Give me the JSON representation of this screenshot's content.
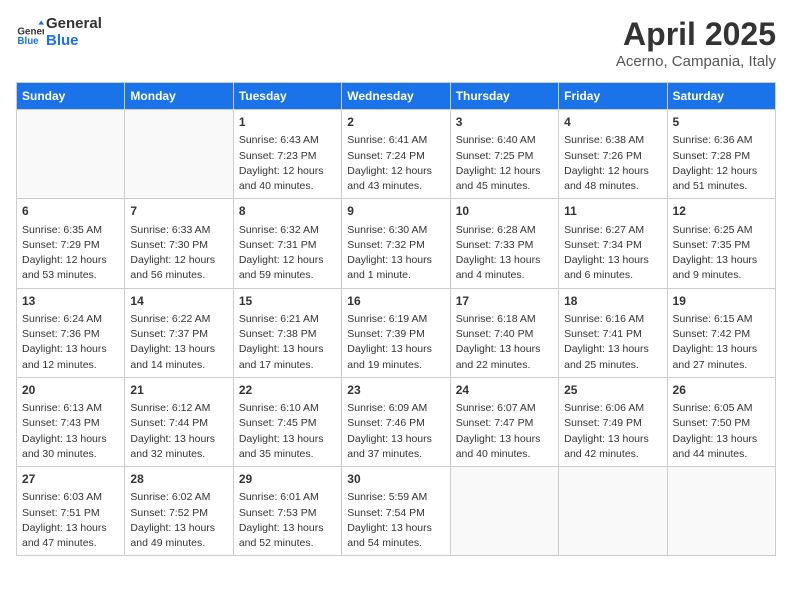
{
  "header": {
    "logo_line1": "General",
    "logo_line2": "Blue",
    "title": "April 2025",
    "subtitle": "Acerno, Campania, Italy"
  },
  "days_of_week": [
    "Sunday",
    "Monday",
    "Tuesday",
    "Wednesday",
    "Thursday",
    "Friday",
    "Saturday"
  ],
  "weeks": [
    [
      {
        "day": "",
        "empty": true
      },
      {
        "day": "",
        "empty": true
      },
      {
        "day": "1",
        "sunrise": "Sunrise: 6:43 AM",
        "sunset": "Sunset: 7:23 PM",
        "daylight": "Daylight: 12 hours and 40 minutes."
      },
      {
        "day": "2",
        "sunrise": "Sunrise: 6:41 AM",
        "sunset": "Sunset: 7:24 PM",
        "daylight": "Daylight: 12 hours and 43 minutes."
      },
      {
        "day": "3",
        "sunrise": "Sunrise: 6:40 AM",
        "sunset": "Sunset: 7:25 PM",
        "daylight": "Daylight: 12 hours and 45 minutes."
      },
      {
        "day": "4",
        "sunrise": "Sunrise: 6:38 AM",
        "sunset": "Sunset: 7:26 PM",
        "daylight": "Daylight: 12 hours and 48 minutes."
      },
      {
        "day": "5",
        "sunrise": "Sunrise: 6:36 AM",
        "sunset": "Sunset: 7:28 PM",
        "daylight": "Daylight: 12 hours and 51 minutes."
      }
    ],
    [
      {
        "day": "6",
        "sunrise": "Sunrise: 6:35 AM",
        "sunset": "Sunset: 7:29 PM",
        "daylight": "Daylight: 12 hours and 53 minutes."
      },
      {
        "day": "7",
        "sunrise": "Sunrise: 6:33 AM",
        "sunset": "Sunset: 7:30 PM",
        "daylight": "Daylight: 12 hours and 56 minutes."
      },
      {
        "day": "8",
        "sunrise": "Sunrise: 6:32 AM",
        "sunset": "Sunset: 7:31 PM",
        "daylight": "Daylight: 12 hours and 59 minutes."
      },
      {
        "day": "9",
        "sunrise": "Sunrise: 6:30 AM",
        "sunset": "Sunset: 7:32 PM",
        "daylight": "Daylight: 13 hours and 1 minute."
      },
      {
        "day": "10",
        "sunrise": "Sunrise: 6:28 AM",
        "sunset": "Sunset: 7:33 PM",
        "daylight": "Daylight: 13 hours and 4 minutes."
      },
      {
        "day": "11",
        "sunrise": "Sunrise: 6:27 AM",
        "sunset": "Sunset: 7:34 PM",
        "daylight": "Daylight: 13 hours and 6 minutes."
      },
      {
        "day": "12",
        "sunrise": "Sunrise: 6:25 AM",
        "sunset": "Sunset: 7:35 PM",
        "daylight": "Daylight: 13 hours and 9 minutes."
      }
    ],
    [
      {
        "day": "13",
        "sunrise": "Sunrise: 6:24 AM",
        "sunset": "Sunset: 7:36 PM",
        "daylight": "Daylight: 13 hours and 12 minutes."
      },
      {
        "day": "14",
        "sunrise": "Sunrise: 6:22 AM",
        "sunset": "Sunset: 7:37 PM",
        "daylight": "Daylight: 13 hours and 14 minutes."
      },
      {
        "day": "15",
        "sunrise": "Sunrise: 6:21 AM",
        "sunset": "Sunset: 7:38 PM",
        "daylight": "Daylight: 13 hours and 17 minutes."
      },
      {
        "day": "16",
        "sunrise": "Sunrise: 6:19 AM",
        "sunset": "Sunset: 7:39 PM",
        "daylight": "Daylight: 13 hours and 19 minutes."
      },
      {
        "day": "17",
        "sunrise": "Sunrise: 6:18 AM",
        "sunset": "Sunset: 7:40 PM",
        "daylight": "Daylight: 13 hours and 22 minutes."
      },
      {
        "day": "18",
        "sunrise": "Sunrise: 6:16 AM",
        "sunset": "Sunset: 7:41 PM",
        "daylight": "Daylight: 13 hours and 25 minutes."
      },
      {
        "day": "19",
        "sunrise": "Sunrise: 6:15 AM",
        "sunset": "Sunset: 7:42 PM",
        "daylight": "Daylight: 13 hours and 27 minutes."
      }
    ],
    [
      {
        "day": "20",
        "sunrise": "Sunrise: 6:13 AM",
        "sunset": "Sunset: 7:43 PM",
        "daylight": "Daylight: 13 hours and 30 minutes."
      },
      {
        "day": "21",
        "sunrise": "Sunrise: 6:12 AM",
        "sunset": "Sunset: 7:44 PM",
        "daylight": "Daylight: 13 hours and 32 minutes."
      },
      {
        "day": "22",
        "sunrise": "Sunrise: 6:10 AM",
        "sunset": "Sunset: 7:45 PM",
        "daylight": "Daylight: 13 hours and 35 minutes."
      },
      {
        "day": "23",
        "sunrise": "Sunrise: 6:09 AM",
        "sunset": "Sunset: 7:46 PM",
        "daylight": "Daylight: 13 hours and 37 minutes."
      },
      {
        "day": "24",
        "sunrise": "Sunrise: 6:07 AM",
        "sunset": "Sunset: 7:47 PM",
        "daylight": "Daylight: 13 hours and 40 minutes."
      },
      {
        "day": "25",
        "sunrise": "Sunrise: 6:06 AM",
        "sunset": "Sunset: 7:49 PM",
        "daylight": "Daylight: 13 hours and 42 minutes."
      },
      {
        "day": "26",
        "sunrise": "Sunrise: 6:05 AM",
        "sunset": "Sunset: 7:50 PM",
        "daylight": "Daylight: 13 hours and 44 minutes."
      }
    ],
    [
      {
        "day": "27",
        "sunrise": "Sunrise: 6:03 AM",
        "sunset": "Sunset: 7:51 PM",
        "daylight": "Daylight: 13 hours and 47 minutes."
      },
      {
        "day": "28",
        "sunrise": "Sunrise: 6:02 AM",
        "sunset": "Sunset: 7:52 PM",
        "daylight": "Daylight: 13 hours and 49 minutes."
      },
      {
        "day": "29",
        "sunrise": "Sunrise: 6:01 AM",
        "sunset": "Sunset: 7:53 PM",
        "daylight": "Daylight: 13 hours and 52 minutes."
      },
      {
        "day": "30",
        "sunrise": "Sunrise: 5:59 AM",
        "sunset": "Sunset: 7:54 PM",
        "daylight": "Daylight: 13 hours and 54 minutes."
      },
      {
        "day": "",
        "empty": true
      },
      {
        "day": "",
        "empty": true
      },
      {
        "day": "",
        "empty": true
      }
    ]
  ]
}
